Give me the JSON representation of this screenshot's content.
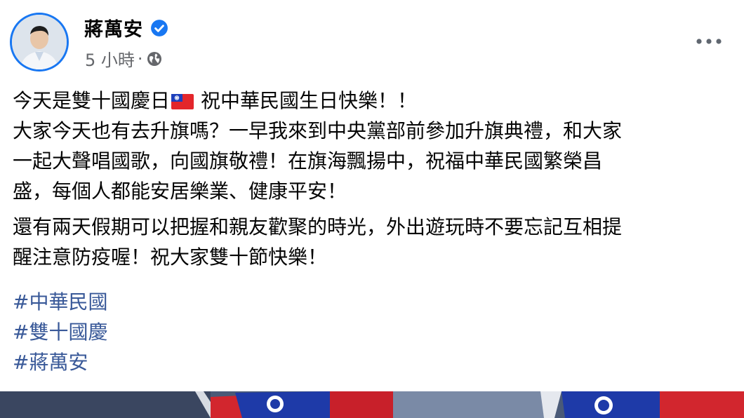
{
  "author": {
    "name": "蔣萬安",
    "verified_icon": "verified-badge-icon",
    "time": "5 小時",
    "separator": "·",
    "privacy_icon": "globe-icon"
  },
  "more_icon": "more-horizontal-icon",
  "post": {
    "paragraphs": [
      {
        "lines": [
          "今天是雙十國慶日",
          "祝中華民國生日快樂！！",
          "大家今天也有去升旗嗎？一早我來到中央黨部前參加升旗典禮，和大家",
          "一起大聲唱國歌，向國旗敬禮！在旗海飄揚中，祝福中華民國繁榮昌",
          "盛，每個人都能安居樂業、健康平安！"
        ]
      },
      {
        "lines": [
          "還有兩天假期可以把握和親友歡聚的時光，外出遊玩時不要忘記互相提",
          "醒注意防疫喔！祝大家雙十節快樂！"
        ]
      }
    ],
    "flag_emoji": "taiwan-flag-icon"
  },
  "hashtags": [
    "#中華民國",
    "#雙十國慶",
    "#蔣萬安"
  ],
  "colors": {
    "accent": "#1877f2",
    "hashtag": "#385898",
    "meta": "#65676b",
    "text": "#050505"
  }
}
